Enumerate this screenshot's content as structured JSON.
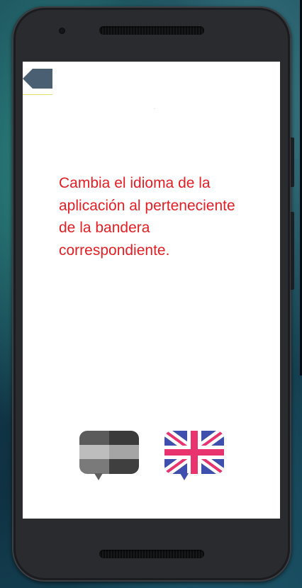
{
  "screen": {
    "instructions": "Cambia el idioma de la aplicación al perteneciente de la bandera correspondiente."
  },
  "icons": {
    "back": "back-arrow-icon",
    "language_1": "flag-chat-bubble-grayscale-icon",
    "language_2": "uk-flag-chat-bubble-icon"
  },
  "colors": {
    "instruction_text": "#e31e24",
    "back_button": "#4b5f72",
    "underline": "#e6dc6a"
  }
}
